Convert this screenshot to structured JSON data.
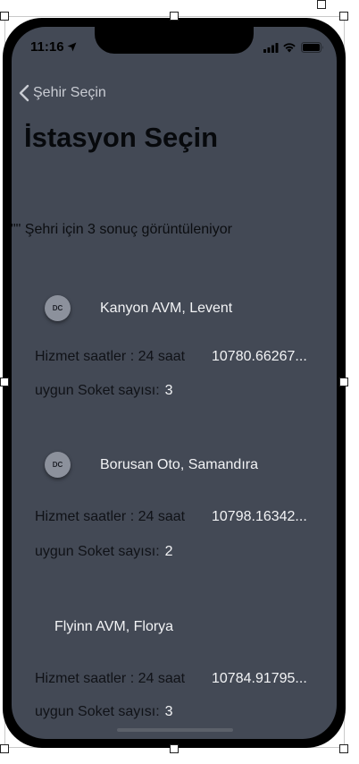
{
  "status_bar": {
    "time": "11:16"
  },
  "nav": {
    "back_label": "Şehir Seçin"
  },
  "title": "İstasyon Seçin",
  "result_info": "\"\" Şehri için 3 sonuç görüntüleniyor",
  "stations": [
    {
      "badge": "DC",
      "name": "Kanyon AVM, Levent",
      "hours": "Hizmet saatler : 24 saat",
      "distance": "10780.66267...",
      "socket_label": "uygun Soket sayısı:",
      "socket_count": "3"
    },
    {
      "badge": "DC",
      "name": "Borusan Oto, Samandıra",
      "hours": "Hizmet saatler : 24 saat",
      "distance": "10798.16342...",
      "socket_label": "uygun Soket sayısı:",
      "socket_count": "2"
    },
    {
      "badge": "",
      "name": "Flyinn AVM, Florya",
      "hours": "Hizmet saatler : 24 saat",
      "distance": "10784.91795...",
      "socket_label": "uygun Soket sayısı:",
      "socket_count": "3"
    }
  ]
}
